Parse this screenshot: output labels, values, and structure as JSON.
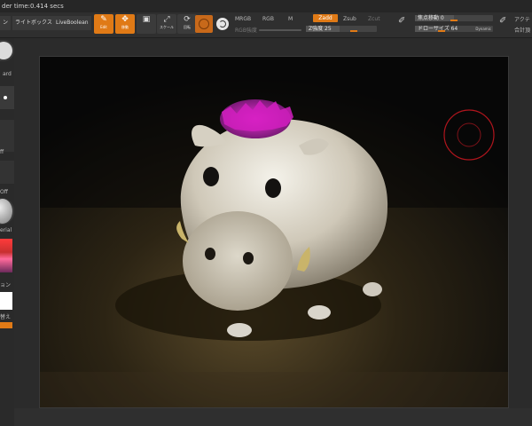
{
  "status": {
    "text": "der time:0.414 secs"
  },
  "toolbar": {
    "tab_left": "ン",
    "tab_lightbox": "ライトボックス",
    "tab_liveboolean": "LiveBoolean",
    "tool_edit": "Edit",
    "tool_move_glyph": "移動",
    "tool_move_label": "移動",
    "tool_scale": "スケール",
    "tool_rotate": "回転",
    "mrgb": "MRGB",
    "rgb": "RGB",
    "m": "M",
    "rgb_intensity": "RGB強度",
    "zadd": "Zadd",
    "zsub": "Zsub",
    "zcut": "Zcut",
    "z_intensity": "Z強度 25",
    "focal_shift": "焦点移動 0",
    "draw_size": "ドローサイズ 64",
    "dynamic": "Dynamic",
    "active_points": "アクテ",
    "total_points": "合計頂",
    "focal_shift_value": 0,
    "draw_size_value": 64,
    "z_intensity_value": 25
  },
  "left_panel": {
    "lbl_ard": "ard",
    "lbl_ff": "ff",
    "lbl_off": "Off",
    "lbl_material": "erial",
    "lbl_gradient": "ョン",
    "lbl_switch": "替え"
  },
  "colors": {
    "accent": "#e07a16",
    "active_fill": "#e07a16",
    "gradient_top": "#ff3b3b"
  }
}
